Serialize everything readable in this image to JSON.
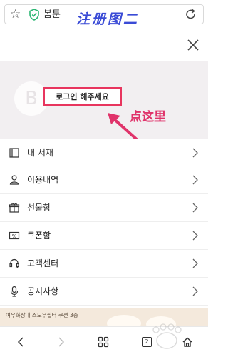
{
  "browser": {
    "url_text": "봄툰",
    "star_icon": "star-icon",
    "reload_icon": "reload-icon"
  },
  "annotations": {
    "title": "注册图二",
    "click_hint": "点这里"
  },
  "profile": {
    "avatar_letter": "B",
    "login_label": "로그인 해주세요"
  },
  "menu": {
    "items": [
      {
        "label": "내 서재",
        "icon": "book-icon"
      },
      {
        "label": "이용내역",
        "icon": "person-icon"
      },
      {
        "label": "선물함",
        "icon": "gift-icon"
      },
      {
        "label": "쿠폰함",
        "icon": "coupon-icon"
      },
      {
        "label": "고객센터",
        "icon": "headset-icon"
      },
      {
        "label": "공지사항",
        "icon": "microphone-icon"
      }
    ]
  },
  "banner": {
    "text": "여우화장대 스노우필터 쿠션 3종"
  },
  "bottom_nav": {
    "tab_count": "2"
  },
  "colors": {
    "highlight": "#e8355e",
    "annotation_blue": "#3a4bd6",
    "profile_bg": "#f2eff1"
  }
}
